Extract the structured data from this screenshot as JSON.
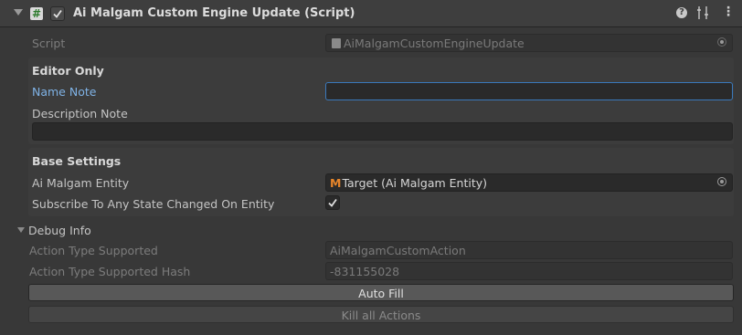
{
  "header": {
    "title": "Ai Malgam Custom Engine Update (Script)",
    "script_glyph": "#",
    "check_glyph": "✓",
    "help_glyph": "?",
    "menu_glyph": "⋮"
  },
  "script_row": {
    "label": "Script",
    "value": "AiMalgamCustomEngineUpdate"
  },
  "editor_only": {
    "heading": "Editor Only",
    "name_note_label": "Name Note",
    "name_note_value": "",
    "description_note_label": "Description Note",
    "description_note_value": ""
  },
  "base_settings": {
    "heading": "Base Settings",
    "entity_label": "Ai Malgam Entity",
    "entity_logo": "M",
    "entity_value": "Target (Ai Malgam Entity)",
    "subscribe_label": "Subscribe To Any State Changed On Entity",
    "subscribe_checked": true,
    "subscribe_glyph": "✓"
  },
  "debug_info": {
    "heading": "Debug Info",
    "action_type_label": "Action Type Supported",
    "action_type_value": "AiMalgamCustomAction",
    "action_hash_label": "Action Type Supported Hash",
    "action_hash_value": "-831155028"
  },
  "buttons": {
    "auto_fill": "Auto Fill",
    "kill_all": "Kill all Actions"
  },
  "colors": {
    "focus_border": "#3a79bb",
    "name_note_label": "#7fb2e5",
    "logo_orange": "#e8862a"
  }
}
